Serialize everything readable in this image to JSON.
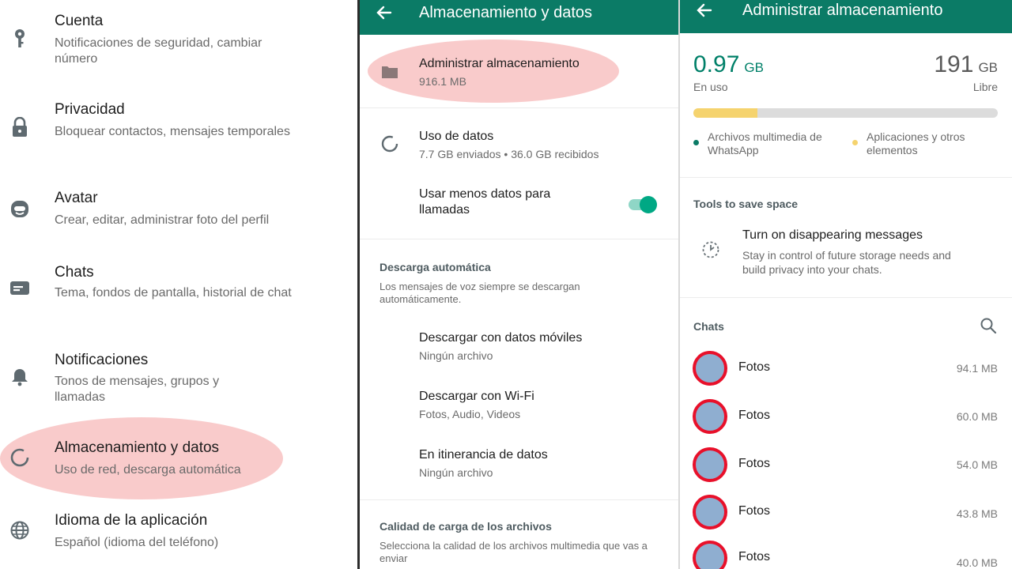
{
  "settings": {
    "items": [
      {
        "title": "Cuenta",
        "subtitle": "Notificaciones de seguridad, cambiar número",
        "icon": "key-icon"
      },
      {
        "title": "Privacidad",
        "subtitle": "Bloquear contactos, mensajes temporales",
        "icon": "lock-icon"
      },
      {
        "title": "Avatar",
        "subtitle": "Crear, editar, administrar foto del perfil",
        "icon": "avatar-icon"
      },
      {
        "title": "Chats",
        "subtitle": "Tema, fondos de pantalla, historial de chat",
        "icon": "chat-icon"
      },
      {
        "title": "Notificaciones",
        "subtitle": "Tonos de mensajes, grupos y llamadas",
        "icon": "bell-icon"
      },
      {
        "title": "Almacenamiento y datos",
        "subtitle": "Uso de red, descarga automática",
        "icon": "data-usage-icon"
      },
      {
        "title": "Idioma de la aplicación",
        "subtitle": "Español (idioma del teléfono)",
        "icon": "globe-icon"
      }
    ]
  },
  "storage_data": {
    "header_title": "Almacenamiento y datos",
    "manage": {
      "title": "Administrar almacenamiento",
      "subtitle": "916.1 MB"
    },
    "data_usage": {
      "title": "Uso de datos",
      "subtitle": "7.7 GB enviados • 36.0 GB recibidos"
    },
    "less_data": {
      "title_line1": "Usar menos datos para",
      "title_line2": "llamadas",
      "enabled": true
    },
    "auto_download": {
      "heading": "Descarga automática",
      "note": "Los mensajes de voz siempre se descargan automáticamente.",
      "mobile": {
        "title": "Descargar con datos móviles",
        "subtitle": "Ningún archivo"
      },
      "wifi": {
        "title": "Descargar con Wi-Fi",
        "subtitle": "Fotos, Audio, Videos"
      },
      "roaming": {
        "title": "En itinerancia de datos",
        "subtitle": "Ningún archivo"
      }
    },
    "upload_quality": {
      "heading": "Calidad de carga de los archivos",
      "note": "Selecciona la calidad de los archivos multimedia que vas a enviar"
    }
  },
  "manage_storage": {
    "header_title": "Administrar almacenamiento",
    "used_value": "0.97",
    "used_unit": "GB",
    "used_label": "En uso",
    "free_value": "191",
    "free_unit": "GB",
    "free_label": "Libre",
    "bar_used_fraction": 0.21,
    "legend_whatsapp": "Archivos multimedia de WhatsApp",
    "legend_apps": "Aplicaciones y otros elementos",
    "tools_heading": "Tools to save space",
    "disappearing_title": "Turn on disappearing messages",
    "disappearing_sub": "Stay in control of future storage needs and build privacy into your chats.",
    "chats_heading": "Chats",
    "chats": [
      {
        "name": "Fotos",
        "size": "94.1 MB"
      },
      {
        "name": "Fotos",
        "size": "60.0 MB"
      },
      {
        "name": "Fotos",
        "size": "54.0 MB"
      },
      {
        "name": "Fotos",
        "size": "43.8 MB"
      },
      {
        "name": "Fotos",
        "size": "40.0 MB"
      }
    ]
  },
  "colors": {
    "header_green": "#0b7b66",
    "accent_green": "#008069",
    "toggle_green": "#00a884",
    "highlight": "#f4a0a0",
    "bar_yellow": "#f5d36e",
    "bar_gray": "#dcdcdc"
  }
}
